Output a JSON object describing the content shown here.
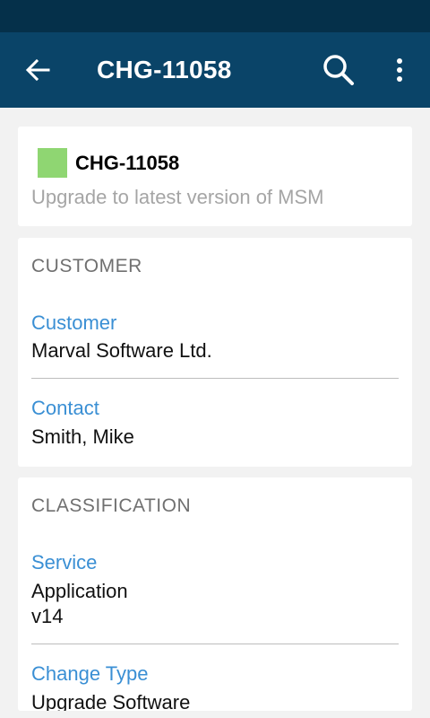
{
  "app_bar": {
    "title": "CHG-11058",
    "back_icon": "arrow-left-icon",
    "search_icon": "search-icon",
    "more_icon": "more-vertical-icon"
  },
  "header_card": {
    "status_color": "#8fd672",
    "reference": "CHG-11058",
    "description": "Upgrade to latest version of MSM"
  },
  "customer_section": {
    "title": "CUSTOMER",
    "fields": [
      {
        "label": "Customer",
        "value": "Marval Software Ltd."
      },
      {
        "label": "Contact",
        "value": "Smith, Mike"
      }
    ]
  },
  "classification_section": {
    "title": "CLASSIFICATION",
    "fields": [
      {
        "label": "Service",
        "value_line1": "Application",
        "value_line2": "v14"
      },
      {
        "label": "Change Type",
        "value": "Upgrade Software"
      }
    ]
  },
  "colors": {
    "status_bar": "#05304a",
    "app_bar": "#0a4468",
    "label_blue": "#3a8fd4",
    "background": "#f2f2f2"
  }
}
